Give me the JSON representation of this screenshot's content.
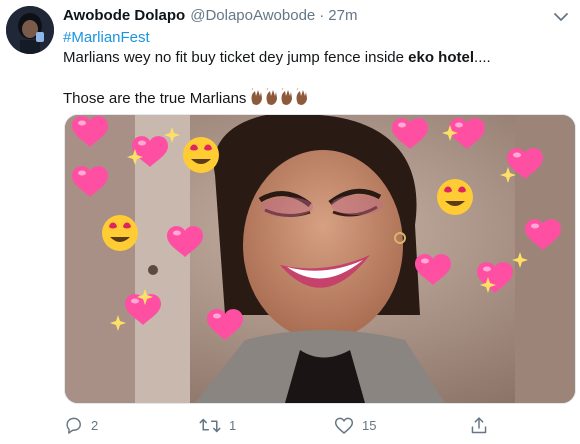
{
  "tweet": {
    "author_name": "Awobode Dolapo",
    "author_handle": "@DolapoAwobode",
    "separator": "·",
    "timestamp": "27m",
    "hashtag": "#MarlianFest",
    "line1_prefix": "Marlians wey no fit buy ticket dey jump fence inside ",
    "line1_bold": "eko hotel",
    "line1_suffix": "....",
    "line2": "Those are the true Marlians",
    "line2_emoji": "👏🏾👏🏾👏🏾👏🏾"
  },
  "media": {
    "alt_icon": "photo-of-smiling-woman-with-heart-and-emoji-stickers"
  },
  "actions": {
    "reply_count": "2",
    "retweet_count": "1",
    "like_count": "15",
    "share_label": ""
  },
  "colors": {
    "link": "#1b95e0",
    "muted": "#657786",
    "heart_pink": "#ff4fa3"
  }
}
